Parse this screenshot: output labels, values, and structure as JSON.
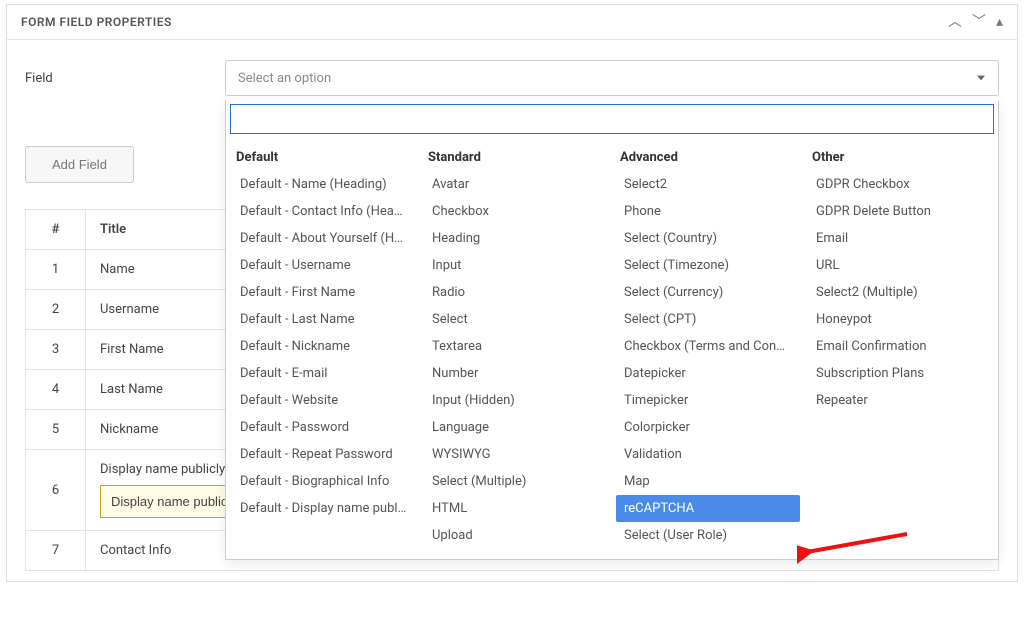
{
  "panel": {
    "title": "FORM FIELD PROPERTIES"
  },
  "field": {
    "label": "Field",
    "placeholder": "Select an option",
    "searchValue": ""
  },
  "dropdown": {
    "groups": [
      {
        "key": "default",
        "header": "Default",
        "options": [
          "Default - Name (Heading)",
          "Default - Contact Info (Heading)",
          "Default - About Yourself (Heading)",
          "Default - Username",
          "Default - First Name",
          "Default - Last Name",
          "Default - Nickname",
          "Default - E-mail",
          "Default - Website",
          "Default - Password",
          "Default - Repeat Password",
          "Default - Biographical Info",
          "Default - Display name publicly as"
        ]
      },
      {
        "key": "standard",
        "header": "Standard",
        "options": [
          "Avatar",
          "Checkbox",
          "Heading",
          "Input",
          "Radio",
          "Select",
          "Textarea",
          "Number",
          "Input (Hidden)",
          "Language",
          "WYSIWYG",
          "Select (Multiple)",
          "HTML",
          "Upload"
        ]
      },
      {
        "key": "advanced",
        "header": "Advanced",
        "options": [
          "Select2",
          "Phone",
          "Select (Country)",
          "Select (Timezone)",
          "Select (Currency)",
          "Select (CPT)",
          "Checkbox (Terms and Conditions)",
          "Datepicker",
          "Timepicker",
          "Colorpicker",
          "Validation",
          "Map",
          "reCAPTCHA",
          "Select (User Role)"
        ],
        "highlightIndex": 12
      },
      {
        "key": "other",
        "header": "Other",
        "options": [
          "GDPR Checkbox",
          "GDPR Delete Button",
          "Email",
          "URL",
          "Select2 (Multiple)",
          "Honeypot",
          "Email Confirmation",
          "Subscription Plans",
          "Repeater"
        ]
      }
    ]
  },
  "buttons": {
    "addField": "Add Field"
  },
  "table": {
    "headers": {
      "num": "#",
      "title": "Title"
    },
    "rows": [
      {
        "num": "1",
        "title": "Name"
      },
      {
        "num": "2",
        "title": "Username"
      },
      {
        "num": "3",
        "title": "First Name"
      },
      {
        "num": "4",
        "title": "Last Name"
      },
      {
        "num": "5",
        "title": "Nickname"
      },
      {
        "num": "6",
        "title": "Display name publicly as",
        "editing": true,
        "editValue": "Display name publicly as"
      },
      {
        "num": "7",
        "title": "Contact Info"
      }
    ]
  }
}
